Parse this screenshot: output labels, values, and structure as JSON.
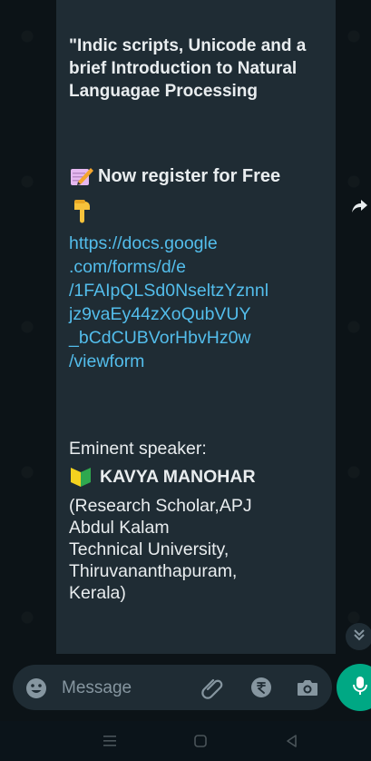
{
  "message": {
    "title": "\"Indic scripts, Unicode and a brief Introduction to Natural Languagae Processing",
    "register": "Now register for Free",
    "link": "https://docs.google\n.com/forms/d/e\n/1FAIpQLSd0NseltzYznnl\njz9vaEy44zXoQubVUY\n_bCdCUBVorHbvHz0w\n/viewform",
    "speaker_label": "Eminent speaker:",
    "speaker_name": "KAVYA MANOHAR",
    "affiliation": "(Research Scholar,APJ\nAbdul Kalam\nTechnical University,\nThiruvananthapuram,\nKerala)"
  },
  "composer": {
    "placeholder": "Message"
  },
  "icons": {
    "emoji": "emoji-icon",
    "attach": "paperclip-icon",
    "payment": "rupee-icon",
    "camera": "camera-icon",
    "mic": "mic-icon",
    "share": "forward-share-icon",
    "scroll": "double-chevron-down-icon"
  },
  "colors": {
    "bubble": "#1f2c34",
    "link": "#53bdeb",
    "accent": "#00a884"
  }
}
